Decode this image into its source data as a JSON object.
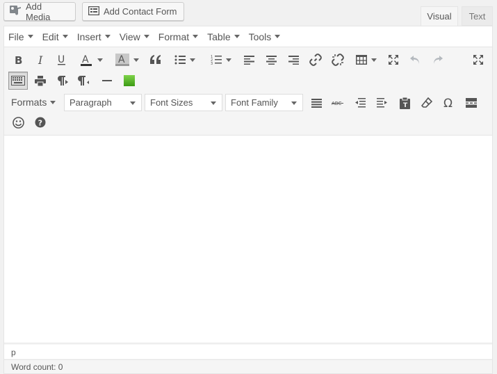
{
  "media_buttons": {
    "add_media": "Add Media",
    "add_contact_form": "Add Contact Form"
  },
  "tabs": {
    "visual": "Visual",
    "text": "Text"
  },
  "menubar": [
    "File",
    "Edit",
    "Insert",
    "View",
    "Format",
    "Table",
    "Tools"
  ],
  "selects": {
    "formats": "Formats",
    "paragraph": "Paragraph",
    "font_sizes": "Font Sizes",
    "font_family": "Font Family"
  },
  "status": {
    "path": "p",
    "word_count": "Word count: 0"
  },
  "colors": {
    "text_color_swatch": "#333333",
    "bg_color_swatch": "#999999",
    "green_button": "#4caf1e"
  }
}
